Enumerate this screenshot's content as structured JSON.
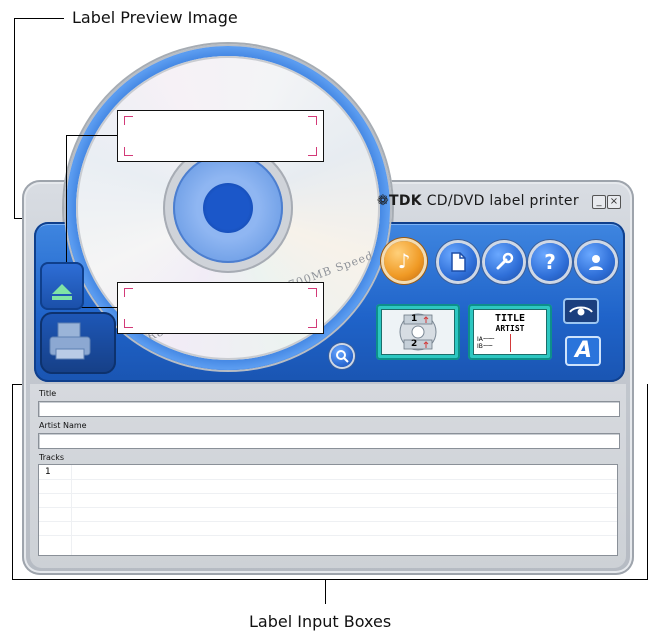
{
  "callouts": {
    "top_label": "Label Preview Image",
    "bottom_label": "Label Input Boxes"
  },
  "app": {
    "brand_logo": "TDK",
    "brand_product": "CD/DVD label printer",
    "window_buttons": {
      "minimize": "_",
      "close": "×"
    },
    "disc_print": "D-R80  CD-RECORDABLE 700MB  Speed",
    "toolbar_icons": [
      "music-note-icon",
      "document-icon",
      "wrench-icon",
      "help-icon",
      "user-icon"
    ],
    "layout_tile_disc": {
      "top_number": "1",
      "bottom_number": "2"
    },
    "layout_tile_text": {
      "title": "TITLE",
      "artist": "ARTIST",
      "line_a": "IA",
      "line_b": "IB"
    },
    "colors": {
      "accent_blue": "#2f6fd8",
      "panel_blue": "#1f63c9",
      "teal": "#2dc7c1",
      "orange": "#f09a25",
      "preview_corner": "#d33a78"
    }
  },
  "form": {
    "title_label": "Title",
    "title_value": "",
    "artist_label": "Artist Name",
    "artist_value": "",
    "tracks_label": "Tracks",
    "tracks_first_number": "1"
  }
}
